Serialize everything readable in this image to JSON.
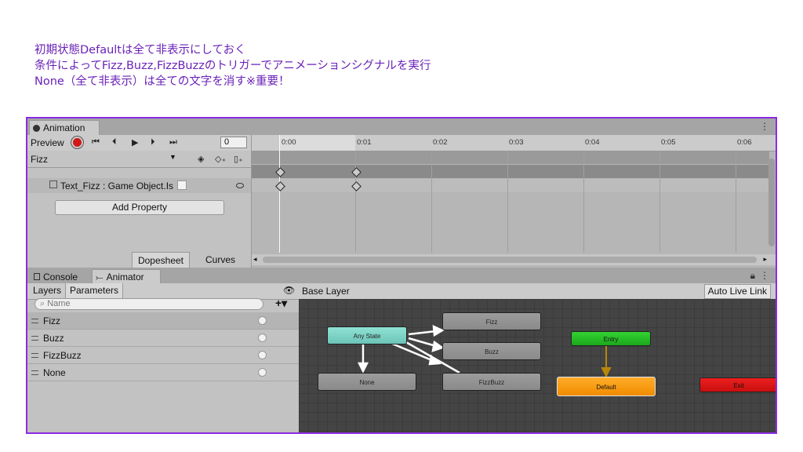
{
  "notes": [
    "初期状態Defaultは全て非表示にしておく",
    "条件によってFizz,Buzz,FizzBuzzのトリガーでアニメーションシグナルを実行",
    "None（全て非表示）は全ての文字を消す※重要！"
  ],
  "animation": {
    "tab_label": "Animation",
    "preview_label": "Preview",
    "frame_value": "0",
    "clip_name": "Fizz",
    "property_label": "Text_Fizz : Game Object.Is",
    "add_property_label": "Add Property",
    "tabs": [
      "Dopesheet",
      "Curves"
    ],
    "active_tab": "Dopesheet",
    "ruler": [
      "0:00",
      "0:01",
      "0:02",
      "0:03",
      "0:04",
      "0:05",
      "0:06"
    ]
  },
  "lower_tabs": {
    "console": "Console",
    "animator": "Animator"
  },
  "params": {
    "tabs": [
      "Layers",
      "Parameters"
    ],
    "active_tab": "Parameters",
    "search_placeholder": "Name",
    "items": [
      "Fizz",
      "Buzz",
      "FizzBuzz",
      "None"
    ]
  },
  "graph": {
    "layer": "Base Layer",
    "auto_live_link": "Auto Live Link",
    "states": {
      "any_state": "Any State",
      "fizz": "Fizz",
      "buzz": "Buzz",
      "fizzbuzz": "FizzBuzz",
      "none": "None",
      "entry": "Entry",
      "default": "Default",
      "exit": "Exit"
    }
  },
  "colors": {
    "annotation": "#6a22b8",
    "frame_border": "#8a2be2",
    "any_state": "#7fd6c9",
    "entry": "#22bb22",
    "default": "#f59a10",
    "exit": "#dd1515"
  }
}
